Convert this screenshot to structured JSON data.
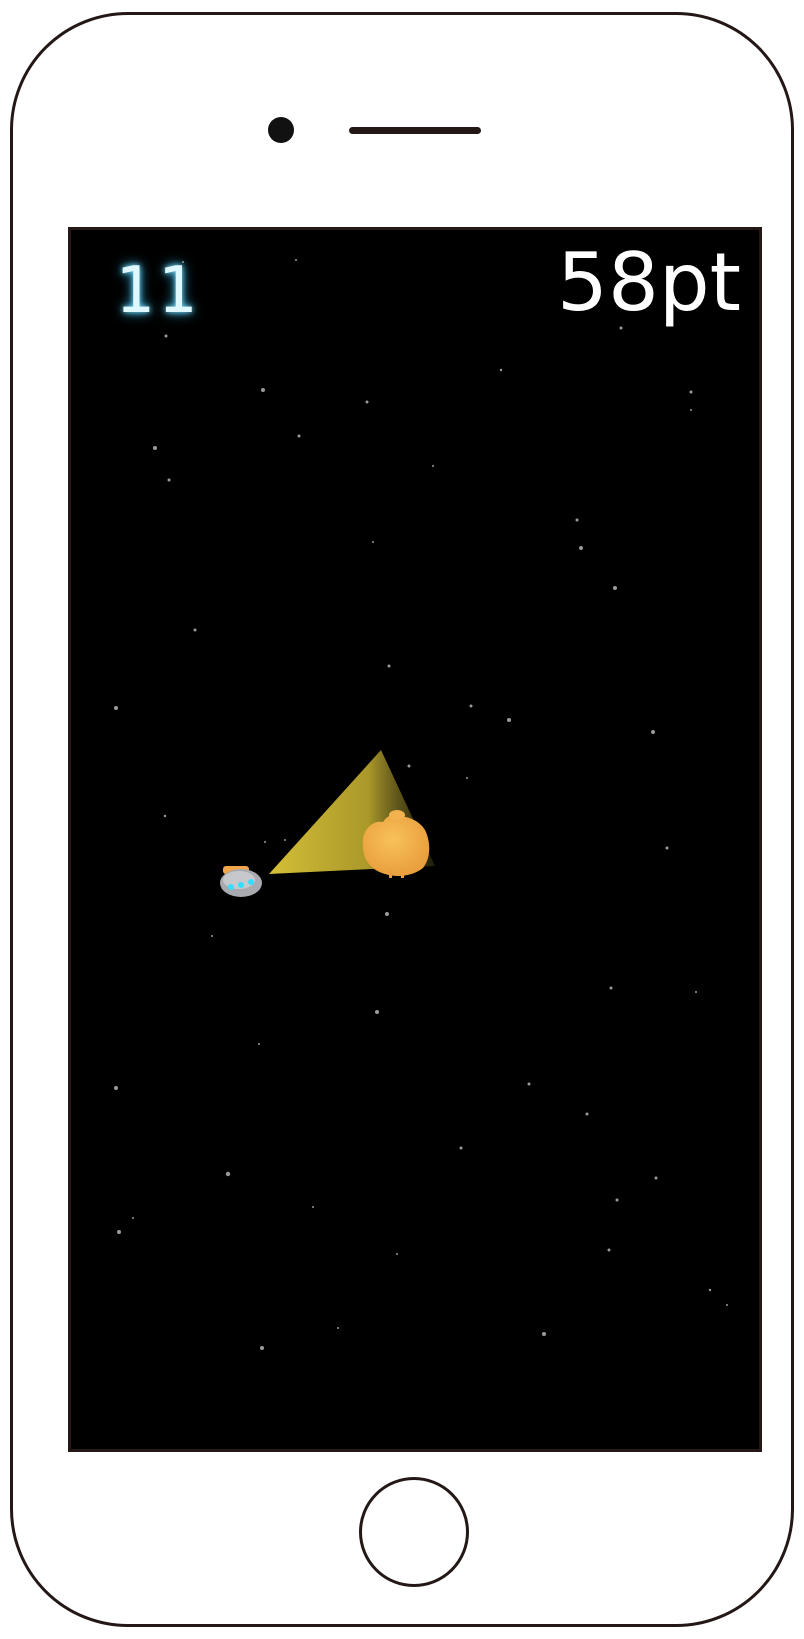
{
  "hud": {
    "level": "11",
    "score": "58pt"
  },
  "colors": {
    "phone_outline": "#231815",
    "screen_background": "#000000",
    "level_glow": "#37c6ff",
    "beam": "#d8c33a",
    "asteroid": "#f2b24d",
    "ship_body": "#a8aab0",
    "ship_lights": "#31e0ff"
  },
  "icons": {
    "player": "ship-icon",
    "target": "asteroid-icon"
  }
}
